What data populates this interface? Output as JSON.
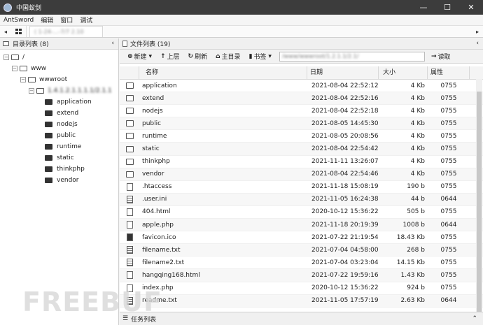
{
  "window": {
    "title": "中国蚁剑",
    "minimize": "—",
    "maximize": "☐",
    "close": "✕"
  },
  "menu": [
    "AntSword",
    "编辑",
    "窗口",
    "调试"
  ],
  "tab": {
    "label": "( 1-24-...-7/7 2.10"
  },
  "left": {
    "title": "目录列表 (8)",
    "collapse": "‹",
    "tree": {
      "root": "/",
      "www": "www",
      "wwwroot": "wwwroot",
      "site": "1.4.1.2.1.1.1.1/2.1.1",
      "children": [
        "application",
        "extend",
        "nodejs",
        "public",
        "runtime",
        "static",
        "thinkphp",
        "vendor"
      ]
    }
  },
  "right": {
    "title": "文件列表 (19)",
    "collapse": "‹",
    "toolbar": {
      "new": "新建",
      "up": "上层",
      "refresh": "刷新",
      "home": "主目录",
      "bookmark": "书签",
      "path": "/www/wwwroot/1.2.1.1/2.1/",
      "read": "读取"
    },
    "columns": {
      "name": "名称",
      "date": "日期",
      "size": "大小",
      "attr": "属性"
    },
    "files": [
      {
        "type": "folder",
        "name": "application",
        "date": "2021-08-04 22:52:12",
        "size": "4 Kb",
        "attr": "0755"
      },
      {
        "type": "folder",
        "name": "extend",
        "date": "2021-08-04 22:52:16",
        "size": "4 Kb",
        "attr": "0755"
      },
      {
        "type": "folder",
        "name": "nodejs",
        "date": "2021-08-04 22:52:18",
        "size": "4 Kb",
        "attr": "0755"
      },
      {
        "type": "folder",
        "name": "public",
        "date": "2021-08-05 14:45:30",
        "size": "4 Kb",
        "attr": "0755"
      },
      {
        "type": "folder",
        "name": "runtime",
        "date": "2021-08-05 20:08:56",
        "size": "4 Kb",
        "attr": "0755"
      },
      {
        "type": "folder",
        "name": "static",
        "date": "2021-08-04 22:54:42",
        "size": "4 Kb",
        "attr": "0755"
      },
      {
        "type": "folder",
        "name": "thinkphp",
        "date": "2021-11-11 13:26:07",
        "size": "4 Kb",
        "attr": "0755"
      },
      {
        "type": "folder",
        "name": "vendor",
        "date": "2021-08-04 22:54:46",
        "size": "4 Kb",
        "attr": "0755"
      },
      {
        "type": "file",
        "name": ".htaccess",
        "date": "2021-11-18 15:08:19",
        "size": "190 b",
        "attr": "0755"
      },
      {
        "type": "txt",
        "name": ".user.ini",
        "date": "2021-11-05 16:24:38",
        "size": "44 b",
        "attr": "0644"
      },
      {
        "type": "html",
        "name": "404.html",
        "date": "2020-10-12 15:36:22",
        "size": "505 b",
        "attr": "0755"
      },
      {
        "type": "php",
        "name": "apple.php",
        "date": "2021-11-18 20:19:39",
        "size": "1008 b",
        "attr": "0644"
      },
      {
        "type": "img",
        "name": "favicon.ico",
        "date": "2021-07-22 21:19:54",
        "size": "18.43 Kb",
        "attr": "0755"
      },
      {
        "type": "txt",
        "name": "filename.txt",
        "date": "2021-07-04 04:58:00",
        "size": "268 b",
        "attr": "0755"
      },
      {
        "type": "txt",
        "name": "filename2.txt",
        "date": "2021-07-04 03:23:04",
        "size": "14.15 Kb",
        "attr": "0755"
      },
      {
        "type": "html",
        "name": "hangqing168.html",
        "date": "2021-07-22 19:59:16",
        "size": "1.43 Kb",
        "attr": "0755"
      },
      {
        "type": "php",
        "name": "index.php",
        "date": "2020-10-12 15:36:22",
        "size": "924 b",
        "attr": "0755"
      },
      {
        "type": "txt",
        "name": "readme.txt",
        "date": "2021-11-05 17:57:19",
        "size": "2.63 Kb",
        "attr": "0644"
      }
    ]
  },
  "bottom": {
    "title": "任务列表",
    "collapse": "⌃"
  },
  "watermark": "FREEBUF"
}
